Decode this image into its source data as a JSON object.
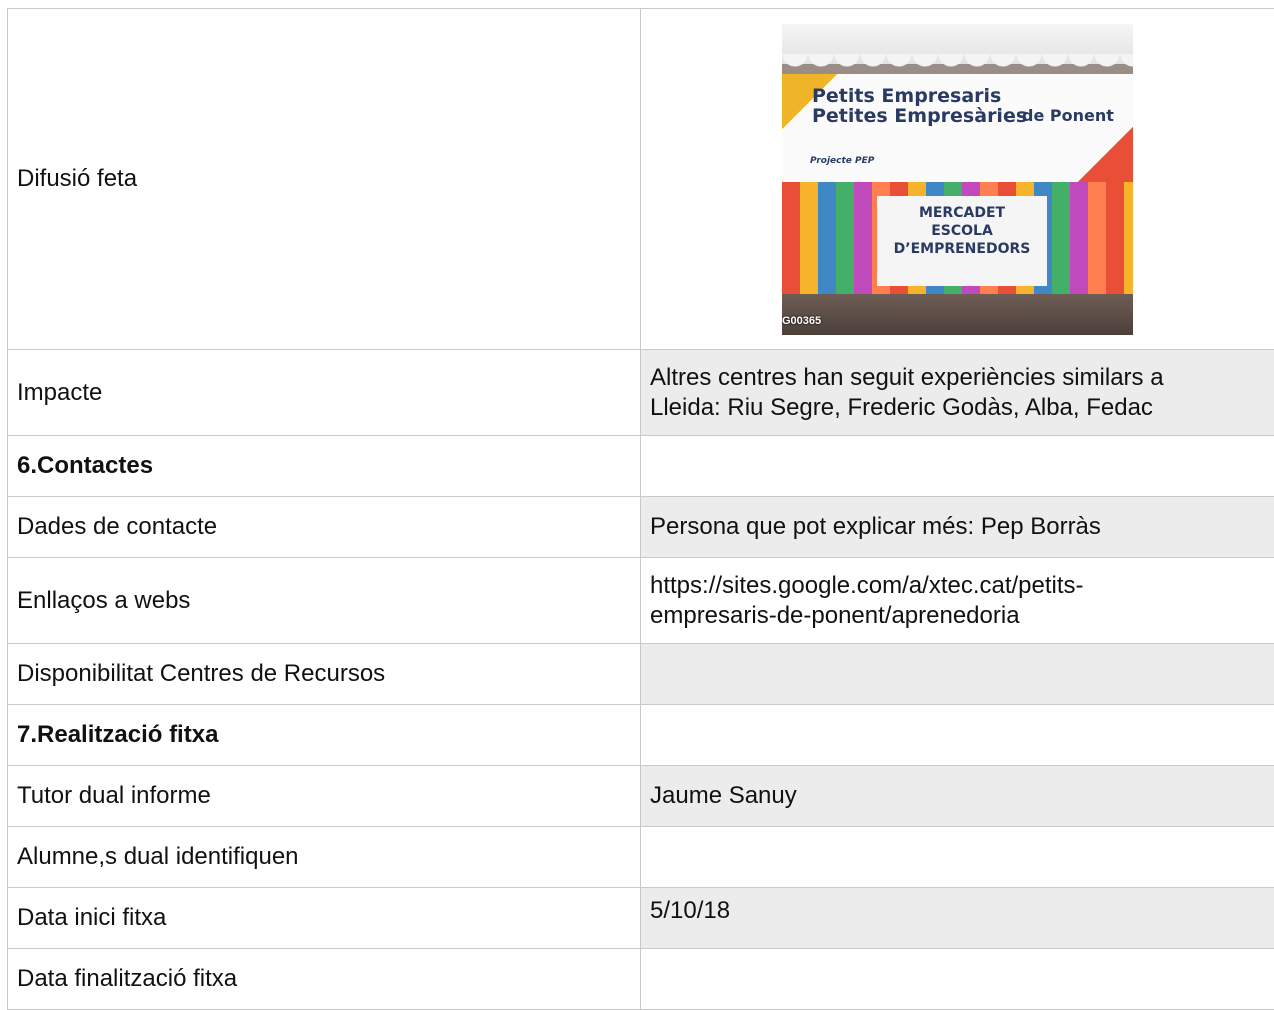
{
  "rows": {
    "difusio": {
      "label": "Difusió feta"
    },
    "photo": {
      "title_line1": "Petits Empresaris",
      "title_line2": "Petites Empresàries",
      "subtitle": "de Ponent",
      "project": "Projecte PEP",
      "sign_line1": "MERCADET",
      "sign_line2": "ESCOLA",
      "sign_line3": "D’EMPRENEDORS",
      "watermark": "G00365"
    },
    "impacte": {
      "label": "Impacte",
      "value_line1": "Altres centres han seguit experiències similars a",
      "value_line2": "Lleida:  Riu Segre, Frederic Godàs, Alba, Fedac"
    },
    "contactes": {
      "label": "6.Contactes",
      "value": ""
    },
    "dades": {
      "label": "Dades de contacte",
      "value": "Persona que pot explicar més: Pep Borràs"
    },
    "enllacos": {
      "label": "Enllaços a webs",
      "value_line1": "https://sites.google.com/a/xtec.cat/petits-",
      "value_line2": "empresaris-de-ponent/aprenedoria"
    },
    "disponibilitat": {
      "label": "Disponibilitat Centres de Recursos",
      "value": ""
    },
    "realitzacio": {
      "label": "7.Realització fitxa",
      "value": ""
    },
    "tutor": {
      "label": "Tutor dual informe",
      "value": "Jaume Sanuy"
    },
    "alumnes": {
      "label": "Alumne,s dual identifiquen",
      "value": ""
    },
    "data_inici": {
      "label": "Data inici fitxa",
      "value": "5/10/18"
    },
    "data_final": {
      "label": "Data finalització fitxa",
      "value": ""
    }
  }
}
